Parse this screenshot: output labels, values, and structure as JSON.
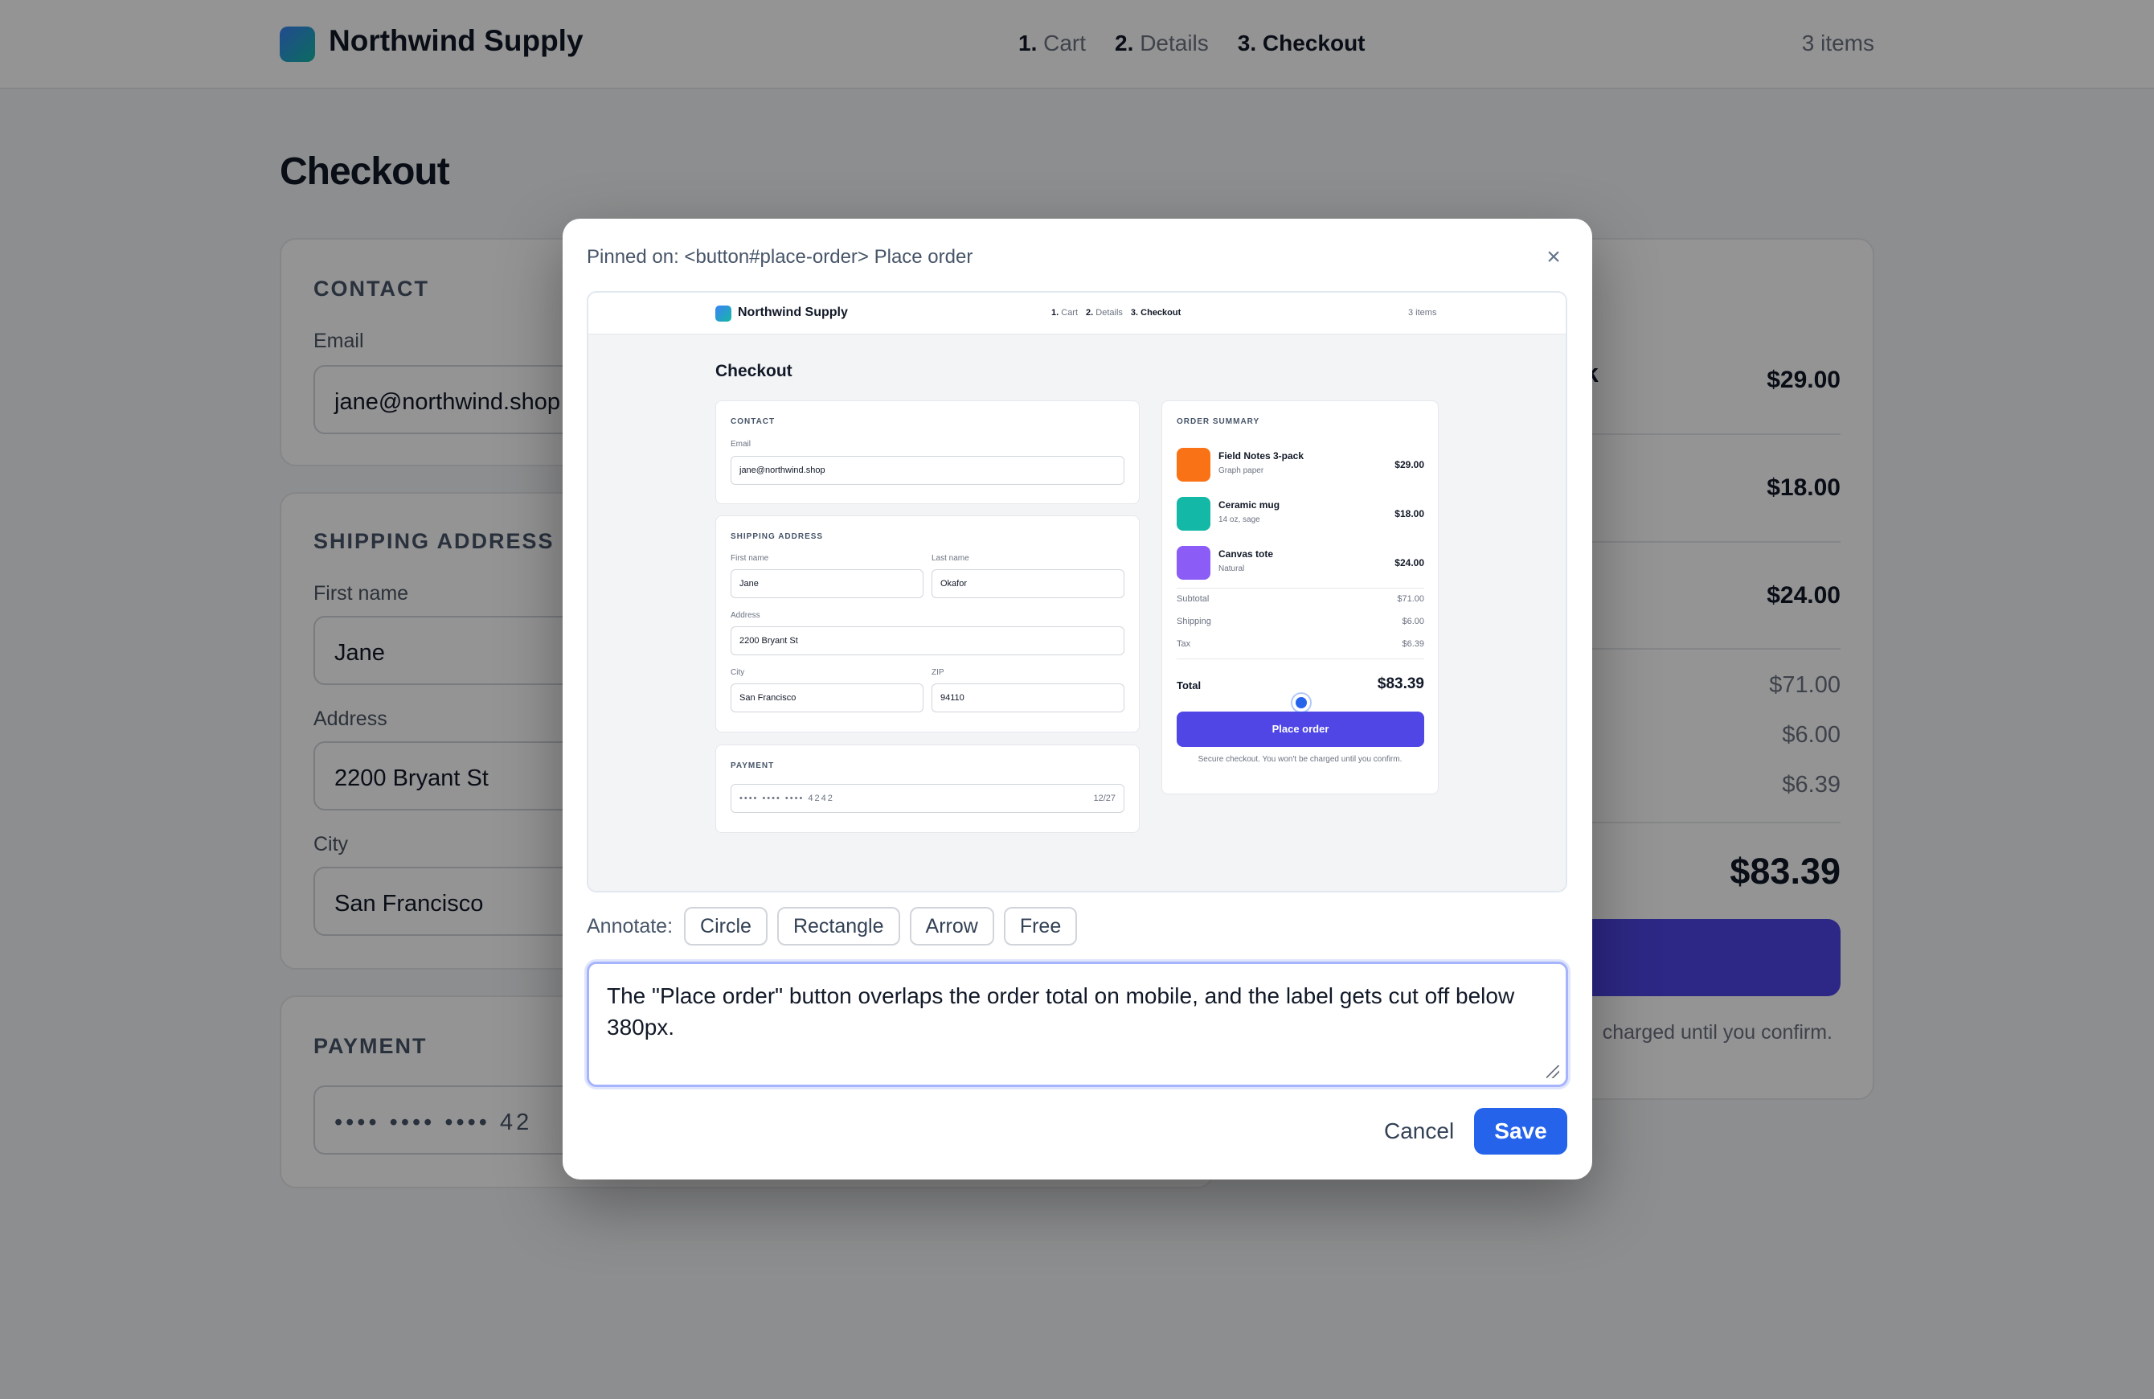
{
  "app": {
    "brand": "Northwind Supply",
    "steps": [
      {
        "num": "1.",
        "label": "Cart"
      },
      {
        "num": "2.",
        "label": "Details"
      },
      {
        "num": "3.",
        "label": "Checkout"
      }
    ],
    "items_count": "3 items"
  },
  "page": {
    "title": "Checkout"
  },
  "contact": {
    "title": "CONTACT",
    "email_label": "Email",
    "email_value": "jane@northwind.shop"
  },
  "shipping": {
    "title": "SHIPPING ADDRESS",
    "first_name_label": "First name",
    "first_name": "Jane",
    "last_name_label": "Last name",
    "last_name": "Okafor",
    "address_label": "Address",
    "address": "2200 Bryant St",
    "city_label": "City",
    "city": "San Francisco",
    "zip_label": "ZIP",
    "zip": "94110"
  },
  "payment": {
    "title": "PAYMENT",
    "card_masked": "•••• •••• •••• 4242",
    "card_visible": "•••• •••• •••• 42",
    "expiry": "12/27"
  },
  "summary": {
    "title": "ORDER SUMMARY",
    "items": [
      {
        "name": "Field Notes 3-pack",
        "sub": "Graph paper",
        "price": "$29.00",
        "color": "#f97316"
      },
      {
        "name": "Ceramic mug",
        "sub": "14 oz, sage",
        "price": "$18.00",
        "color": "#14b8a6"
      },
      {
        "name": "Canvas tote",
        "sub": "Natural",
        "price": "$24.00",
        "color": "#8b5cf6"
      }
    ],
    "subtotal_label": "Subtotal",
    "subtotal": "$71.00",
    "shipping_label": "Shipping",
    "shipping": "$6.00",
    "tax_label": "Tax",
    "tax": "$6.39",
    "total_label": "Total",
    "total": "$83.39",
    "place_order": "Place order",
    "place_order_visible": "rder",
    "secure_note": "Secure checkout. You won't be charged until you confirm.",
    "secure_note_visible": "charged until you confirm.",
    "partial_k": "k"
  },
  "modal": {
    "pinned": "Pinned on: <button#place-order> Place order",
    "close": "×",
    "annotate_label": "Annotate:",
    "tools": [
      "Circle",
      "Rectangle",
      "Arrow",
      "Free"
    ],
    "note": "The \"Place order\" button overlaps the order total on mobile, and the label gets cut off below 380px.",
    "cancel": "Cancel",
    "save": "Save"
  },
  "colors": {
    "primary": "#2563eb",
    "accent": "#4f46e5",
    "focus": "#a5b4fc"
  }
}
